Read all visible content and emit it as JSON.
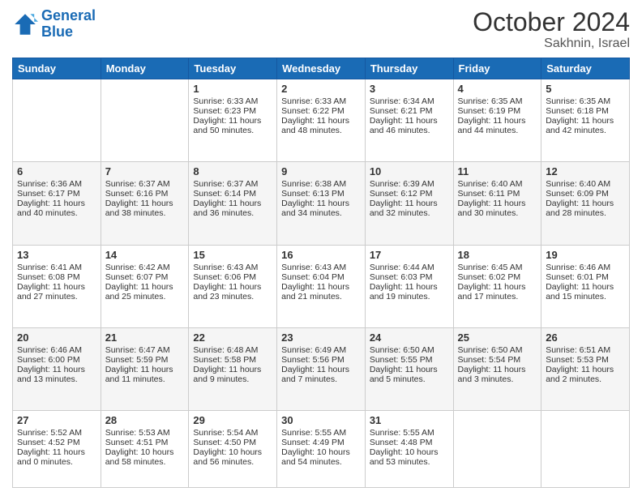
{
  "header": {
    "logo_line1": "General",
    "logo_line2": "Blue",
    "month": "October 2024",
    "location": "Sakhnin, Israel"
  },
  "weekdays": [
    "Sunday",
    "Monday",
    "Tuesday",
    "Wednesday",
    "Thursday",
    "Friday",
    "Saturday"
  ],
  "weeks": [
    [
      {
        "day": "",
        "info": ""
      },
      {
        "day": "",
        "info": ""
      },
      {
        "day": "1",
        "info": "Sunrise: 6:33 AM\nSunset: 6:23 PM\nDaylight: 11 hours and 50 minutes."
      },
      {
        "day": "2",
        "info": "Sunrise: 6:33 AM\nSunset: 6:22 PM\nDaylight: 11 hours and 48 minutes."
      },
      {
        "day": "3",
        "info": "Sunrise: 6:34 AM\nSunset: 6:21 PM\nDaylight: 11 hours and 46 minutes."
      },
      {
        "day": "4",
        "info": "Sunrise: 6:35 AM\nSunset: 6:19 PM\nDaylight: 11 hours and 44 minutes."
      },
      {
        "day": "5",
        "info": "Sunrise: 6:35 AM\nSunset: 6:18 PM\nDaylight: 11 hours and 42 minutes."
      }
    ],
    [
      {
        "day": "6",
        "info": "Sunrise: 6:36 AM\nSunset: 6:17 PM\nDaylight: 11 hours and 40 minutes."
      },
      {
        "day": "7",
        "info": "Sunrise: 6:37 AM\nSunset: 6:16 PM\nDaylight: 11 hours and 38 minutes."
      },
      {
        "day": "8",
        "info": "Sunrise: 6:37 AM\nSunset: 6:14 PM\nDaylight: 11 hours and 36 minutes."
      },
      {
        "day": "9",
        "info": "Sunrise: 6:38 AM\nSunset: 6:13 PM\nDaylight: 11 hours and 34 minutes."
      },
      {
        "day": "10",
        "info": "Sunrise: 6:39 AM\nSunset: 6:12 PM\nDaylight: 11 hours and 32 minutes."
      },
      {
        "day": "11",
        "info": "Sunrise: 6:40 AM\nSunset: 6:11 PM\nDaylight: 11 hours and 30 minutes."
      },
      {
        "day": "12",
        "info": "Sunrise: 6:40 AM\nSunset: 6:09 PM\nDaylight: 11 hours and 28 minutes."
      }
    ],
    [
      {
        "day": "13",
        "info": "Sunrise: 6:41 AM\nSunset: 6:08 PM\nDaylight: 11 hours and 27 minutes."
      },
      {
        "day": "14",
        "info": "Sunrise: 6:42 AM\nSunset: 6:07 PM\nDaylight: 11 hours and 25 minutes."
      },
      {
        "day": "15",
        "info": "Sunrise: 6:43 AM\nSunset: 6:06 PM\nDaylight: 11 hours and 23 minutes."
      },
      {
        "day": "16",
        "info": "Sunrise: 6:43 AM\nSunset: 6:04 PM\nDaylight: 11 hours and 21 minutes."
      },
      {
        "day": "17",
        "info": "Sunrise: 6:44 AM\nSunset: 6:03 PM\nDaylight: 11 hours and 19 minutes."
      },
      {
        "day": "18",
        "info": "Sunrise: 6:45 AM\nSunset: 6:02 PM\nDaylight: 11 hours and 17 minutes."
      },
      {
        "day": "19",
        "info": "Sunrise: 6:46 AM\nSunset: 6:01 PM\nDaylight: 11 hours and 15 minutes."
      }
    ],
    [
      {
        "day": "20",
        "info": "Sunrise: 6:46 AM\nSunset: 6:00 PM\nDaylight: 11 hours and 13 minutes."
      },
      {
        "day": "21",
        "info": "Sunrise: 6:47 AM\nSunset: 5:59 PM\nDaylight: 11 hours and 11 minutes."
      },
      {
        "day": "22",
        "info": "Sunrise: 6:48 AM\nSunset: 5:58 PM\nDaylight: 11 hours and 9 minutes."
      },
      {
        "day": "23",
        "info": "Sunrise: 6:49 AM\nSunset: 5:56 PM\nDaylight: 11 hours and 7 minutes."
      },
      {
        "day": "24",
        "info": "Sunrise: 6:50 AM\nSunset: 5:55 PM\nDaylight: 11 hours and 5 minutes."
      },
      {
        "day": "25",
        "info": "Sunrise: 6:50 AM\nSunset: 5:54 PM\nDaylight: 11 hours and 3 minutes."
      },
      {
        "day": "26",
        "info": "Sunrise: 6:51 AM\nSunset: 5:53 PM\nDaylight: 11 hours and 2 minutes."
      }
    ],
    [
      {
        "day": "27",
        "info": "Sunrise: 5:52 AM\nSunset: 4:52 PM\nDaylight: 11 hours and 0 minutes."
      },
      {
        "day": "28",
        "info": "Sunrise: 5:53 AM\nSunset: 4:51 PM\nDaylight: 10 hours and 58 minutes."
      },
      {
        "day": "29",
        "info": "Sunrise: 5:54 AM\nSunset: 4:50 PM\nDaylight: 10 hours and 56 minutes."
      },
      {
        "day": "30",
        "info": "Sunrise: 5:55 AM\nSunset: 4:49 PM\nDaylight: 10 hours and 54 minutes."
      },
      {
        "day": "31",
        "info": "Sunrise: 5:55 AM\nSunset: 4:48 PM\nDaylight: 10 hours and 53 minutes."
      },
      {
        "day": "",
        "info": ""
      },
      {
        "day": "",
        "info": ""
      }
    ]
  ]
}
